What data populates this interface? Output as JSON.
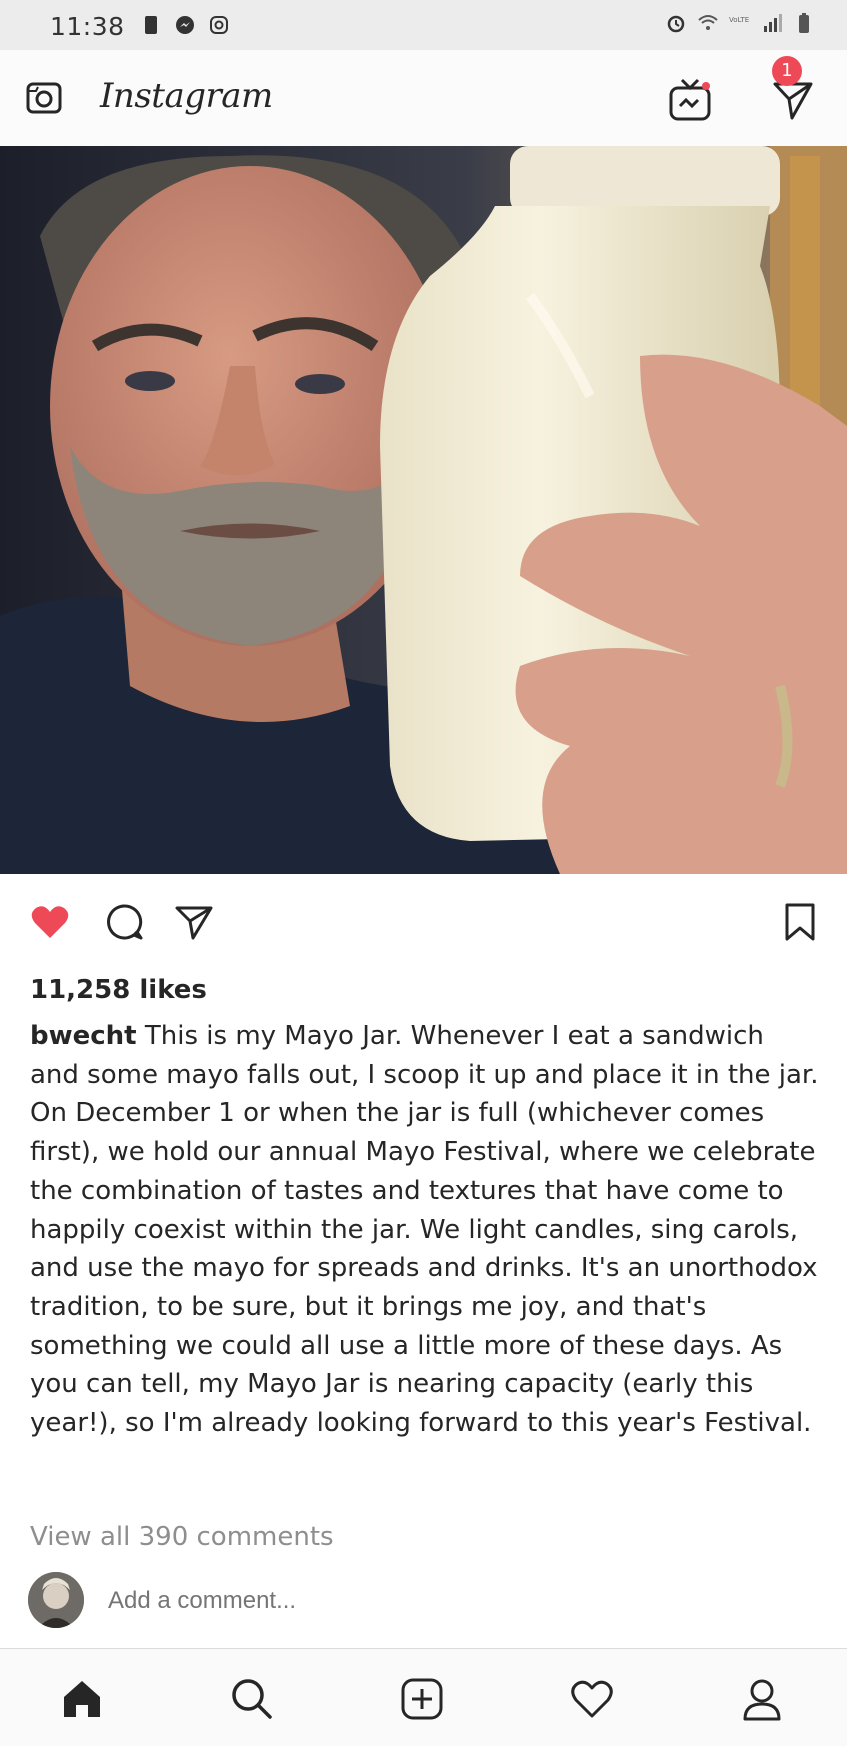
{
  "status_bar": {
    "time": "11:38",
    "left_icons": [
      "sim-card-icon",
      "messenger-icon",
      "instagram-notification-icon"
    ],
    "right_icons": [
      "alarm-icon",
      "wifi-icon",
      "volte-icon",
      "signal-icon",
      "battery-icon"
    ]
  },
  "header": {
    "brand": "Instagram",
    "camera_icon": "camera-icon",
    "igtv_icon": "igtv-icon",
    "direct_icon": "direct-message-icon",
    "direct_badge": "1"
  },
  "post": {
    "image_icon": "post-photo",
    "liked": true,
    "like_color": "#ed4956",
    "likes": "11,258 likes",
    "username": "bwecht",
    "caption": "This is my Mayo Jar. Whenever I eat a sandwich and some mayo falls out, I scoop it up and place it in the jar. On December 1 or when the jar is full (whichever comes first), we hold our annual Mayo Festival, where we celebrate the combination of tastes and textures that have come to happily coexist within the jar. We light candles, sing carols, and use the mayo for spreads and drinks. It's an unorthodox tradition, to be sure, but it brings me joy, and that's something we could all use a little more of these days. As you can tell, my Mayo Jar is nearing capacity (early this year!), so I'm already looking forward to this year's Festival.",
    "view_comments": "View all 390 comments",
    "comment_placeholder": "Add a comment..."
  },
  "bottom_nav": {
    "items": [
      "home-icon",
      "search-icon",
      "add-post-icon",
      "activity-heart-icon",
      "profile-icon"
    ]
  }
}
